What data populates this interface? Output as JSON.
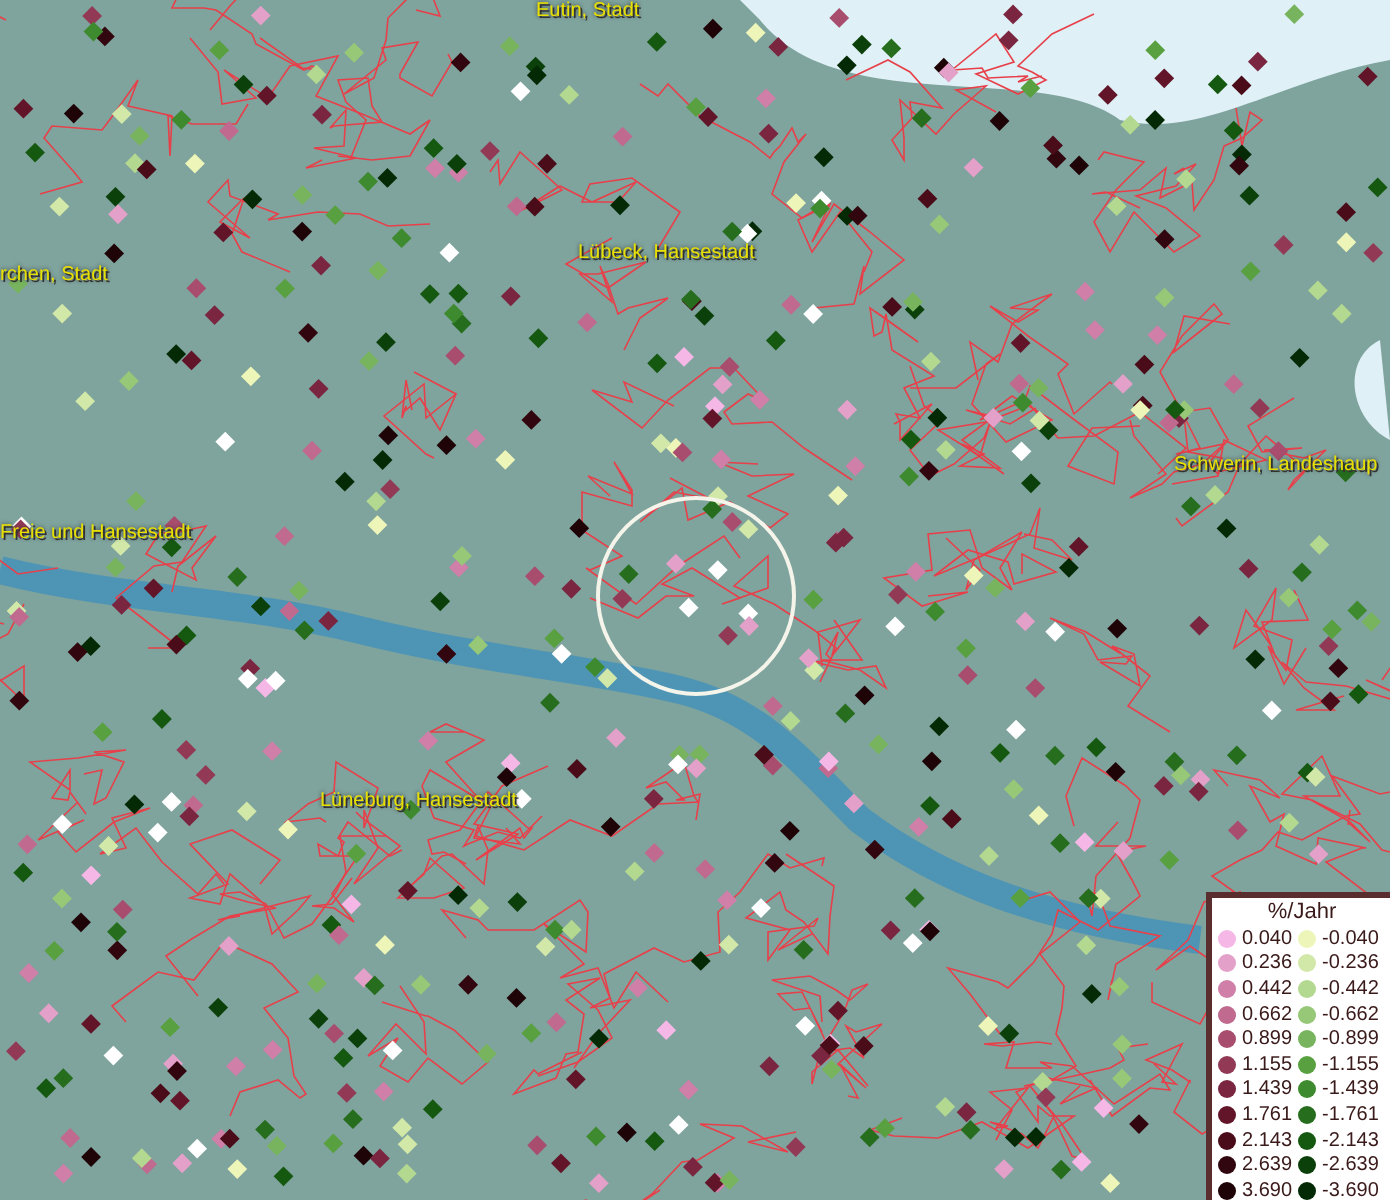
{
  "map": {
    "places": [
      {
        "name": "Eutin, Stadt"
      },
      {
        "name": "Lübeck, Hansestadt"
      },
      {
        "name": "rchen, Stadt"
      },
      {
        "name": "Schwerin, Landeshaup"
      },
      {
        "name": "Freie und Hansestadt"
      },
      {
        "name": "Lüneburg, Hansestadt"
      }
    ]
  },
  "legend": {
    "title": "%/Jahr",
    "columns": [
      {
        "items": [
          {
            "value": "0.040",
            "color": "#f5b8e6"
          },
          {
            "value": "0.236",
            "color": "#e3a0c8"
          },
          {
            "value": "0.442",
            "color": "#cf7fa8"
          },
          {
            "value": "0.662",
            "color": "#c06a8f"
          },
          {
            "value": "0.899",
            "color": "#a84d6e"
          },
          {
            "value": "1.155",
            "color": "#923a55"
          },
          {
            "value": "1.439",
            "color": "#7a2640"
          },
          {
            "value": "1.761",
            "color": "#621528"
          },
          {
            "value": "2.143",
            "color": "#4a0c18"
          },
          {
            "value": "2.639",
            "color": "#32060e"
          },
          {
            "value": "3.690",
            "color": "#1e0307"
          }
        ]
      },
      {
        "items": [
          {
            "value": "-0.040",
            "color": "#eef5b8"
          },
          {
            "value": "-0.236",
            "color": "#d2e8a8"
          },
          {
            "value": "-0.442",
            "color": "#b3d890"
          },
          {
            "value": "-0.662",
            "color": "#96c878"
          },
          {
            "value": "-0.899",
            "color": "#78b45e"
          },
          {
            "value": "-1.155",
            "color": "#58a040"
          },
          {
            "value": "-1.439",
            "color": "#3e8a2e"
          },
          {
            "value": "-1.761",
            "color": "#266e1e"
          },
          {
            "value": "-2.143",
            "color": "#155810"
          },
          {
            "value": "-2.639",
            "color": "#0b400a"
          },
          {
            "value": "-3.690",
            "color": "#042a05"
          }
        ]
      }
    ]
  }
}
